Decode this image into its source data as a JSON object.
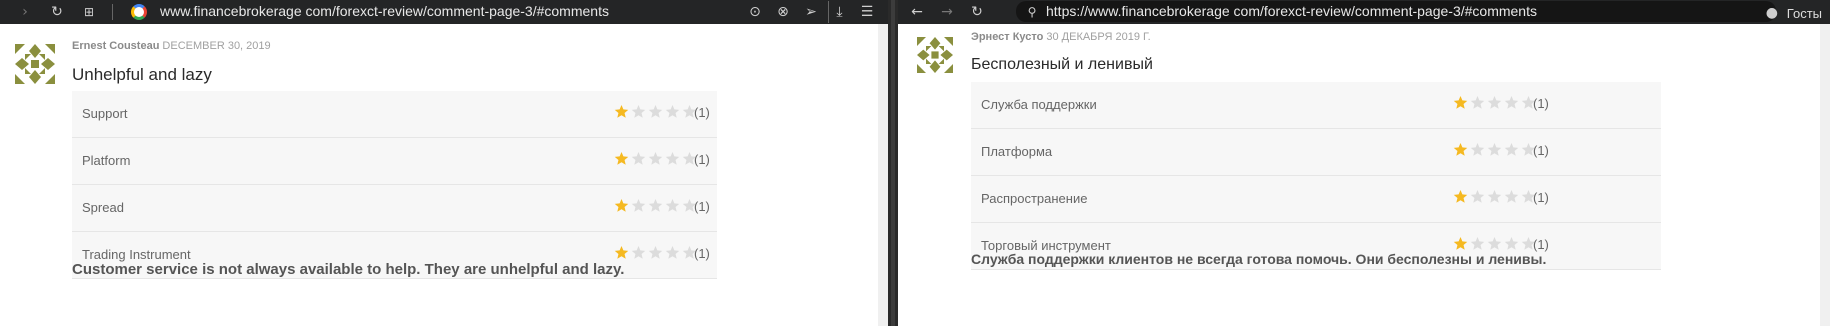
{
  "left": {
    "url": "www.financebrokerage com/forexct-review/comment-page-3/#comments",
    "author": "Ernest Cousteau",
    "date": "DECEMBER 30, 2019",
    "title": "Unhelpful and lazy",
    "ratings": [
      {
        "label": "Support",
        "score": 1,
        "max": 5,
        "count": "(1)"
      },
      {
        "label": "Platform",
        "score": 1,
        "max": 5,
        "count": "(1)"
      },
      {
        "label": "Spread",
        "score": 1,
        "max": 5,
        "count": "(1)"
      },
      {
        "label": "Trading Instrument",
        "score": 1,
        "max": 5,
        "count": "(1)"
      }
    ],
    "body": "Customer service is not always available to help. They are unhelpful and lazy."
  },
  "right": {
    "url": "https://www.financebrokerage com/forexct-review/comment-page-3/#comments",
    "profile_label": "Госты",
    "author": "Эрнест Кусто",
    "date": "30 ДЕКАБРЯ 2019 Г.",
    "title": "Бесполезный и ленивый",
    "ratings": [
      {
        "label": "Служба поддержки",
        "score": 1,
        "max": 5,
        "count": "(1)"
      },
      {
        "label": "Платформа",
        "score": 1,
        "max": 5,
        "count": "(1)"
      },
      {
        "label": "Распространение",
        "score": 1,
        "max": 5,
        "count": "(1)"
      },
      {
        "label": "Торговый инструмент",
        "score": 1,
        "max": 5,
        "count": "(1)"
      }
    ],
    "body": "Служба поддержки клиентов не всегда готова помочь. Они бесполезны и ленивы."
  },
  "colors": {
    "star_filled": "#f5b921",
    "star_empty": "#dcdcdc",
    "avatar": "#8a8f3e",
    "toolbar": "#242526"
  }
}
